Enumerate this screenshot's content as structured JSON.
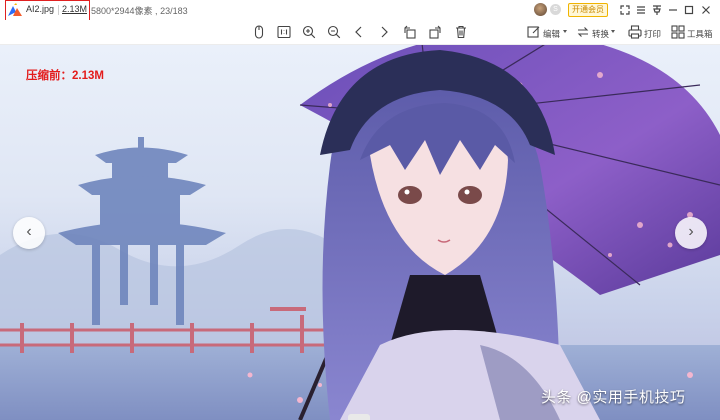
{
  "titlebar": {
    "filename": "AI2.jpg",
    "filesize": "2.13M",
    "dimensions": "5800*2944像素",
    "index": "23/183",
    "vip_button": "开通会员",
    "badge_s": "S",
    "icons": [
      "expand-icon",
      "menu-icon",
      "pin-icon",
      "minimize-icon",
      "maximize-icon",
      "close-icon"
    ]
  },
  "toolbar": {
    "edit_label": "编辑",
    "convert_label": "转换",
    "print_label": "打印",
    "toolbox_label": "工具箱",
    "icons": [
      "mouse-icon",
      "actual-size-icon",
      "zoom-in-icon",
      "zoom-out-icon",
      "prev-icon",
      "next-icon",
      "rotate-left-icon",
      "rotate-right-icon",
      "delete-icon"
    ]
  },
  "canvas": {
    "compress_label": "压缩前：2.13M",
    "watermark": "头条 @实用手机技巧",
    "nav_prev": "‹",
    "nav_next": "›"
  },
  "colors": {
    "annotation_red": "#e31b1b",
    "vip_gold": "#f0b400"
  }
}
